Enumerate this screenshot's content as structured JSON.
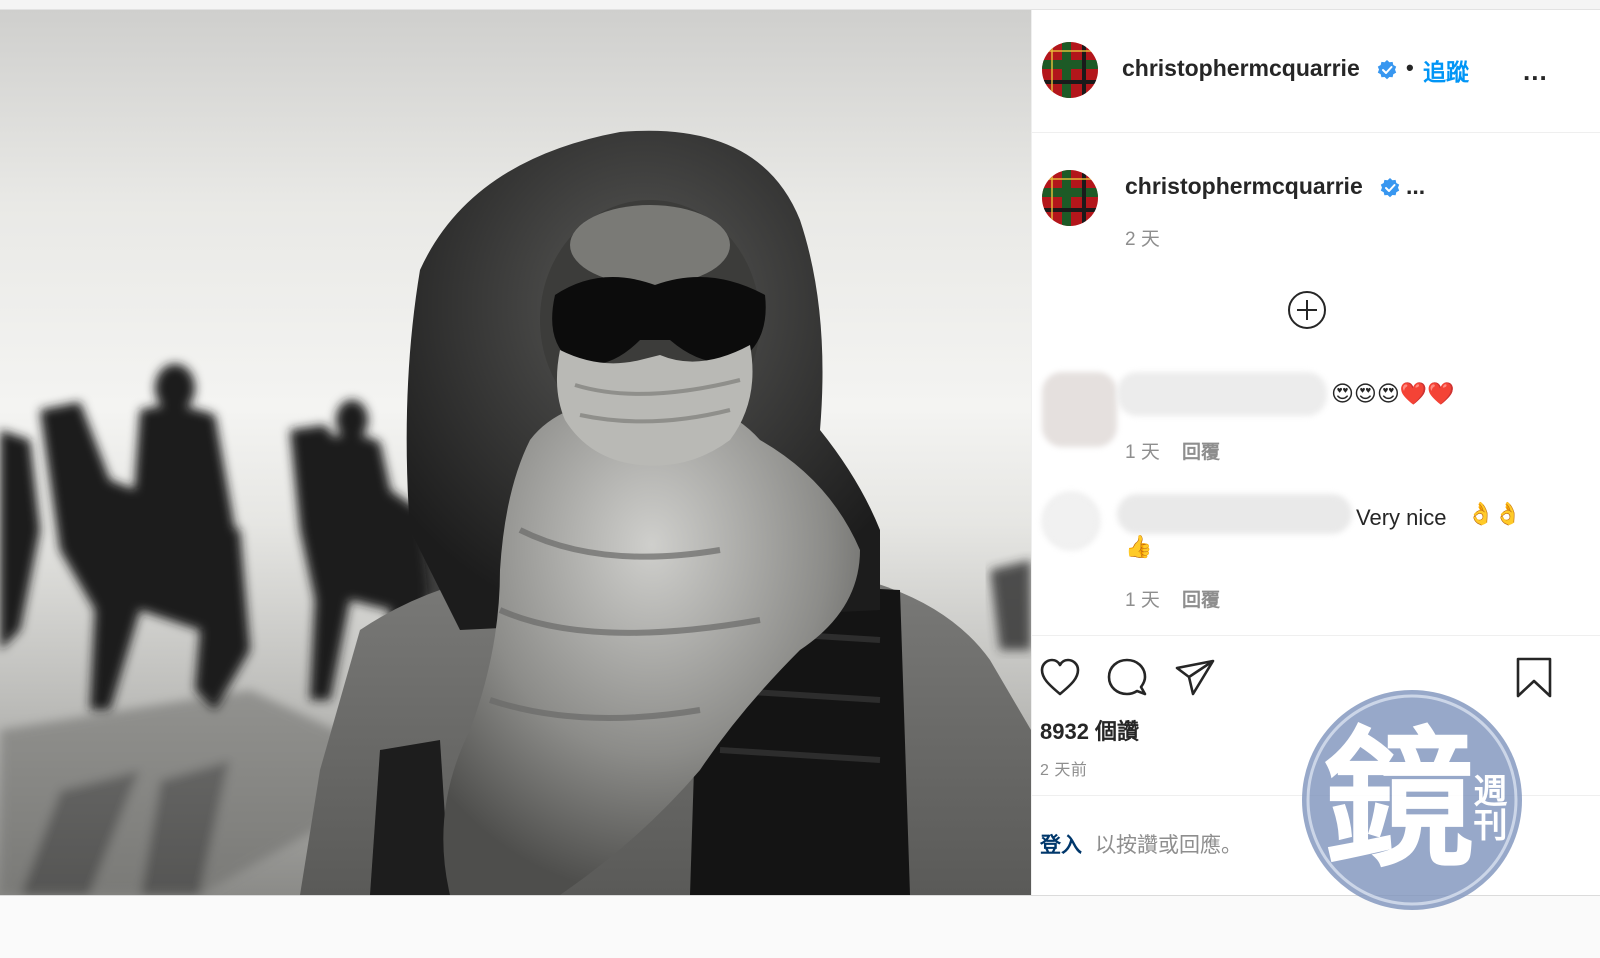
{
  "post": {
    "header": {
      "username": "christophermcquarrie",
      "separator": "•",
      "follow_label": "追蹤",
      "more_label": "..."
    },
    "caption": {
      "username": "christophermcquarrie",
      "ellipsis": "...",
      "time": "2 天"
    },
    "comments": [
      {
        "author": "",
        "text": "",
        "emojis": "😍😍😍❤️❤️",
        "time": "1 天",
        "reply_label": "回覆"
      },
      {
        "author": "",
        "text": "Very nice",
        "emojis": "👌👌",
        "emojis_line2": "👍",
        "time": "1 天",
        "reply_label": "回覆"
      }
    ],
    "likes": "8932 個讚",
    "posted_ago": "2 天前",
    "login": {
      "link_label": "登入",
      "text": "以按讚或回應。"
    }
  },
  "watermark": {
    "main_char": "鏡",
    "sub_chars": "週刊"
  },
  "colors": {
    "link_blue": "#0095f6",
    "verified_blue": "#3897f0",
    "heart_red": "#ed4956",
    "watermark_blue": "#2a5aa8"
  },
  "icons": {
    "like": "heart-outline-icon",
    "comment": "comment-bubble-icon",
    "share": "paper-plane-icon",
    "save": "bookmark-icon",
    "add_comment": "plus-circle-icon",
    "verified": "verified-badge-icon"
  }
}
